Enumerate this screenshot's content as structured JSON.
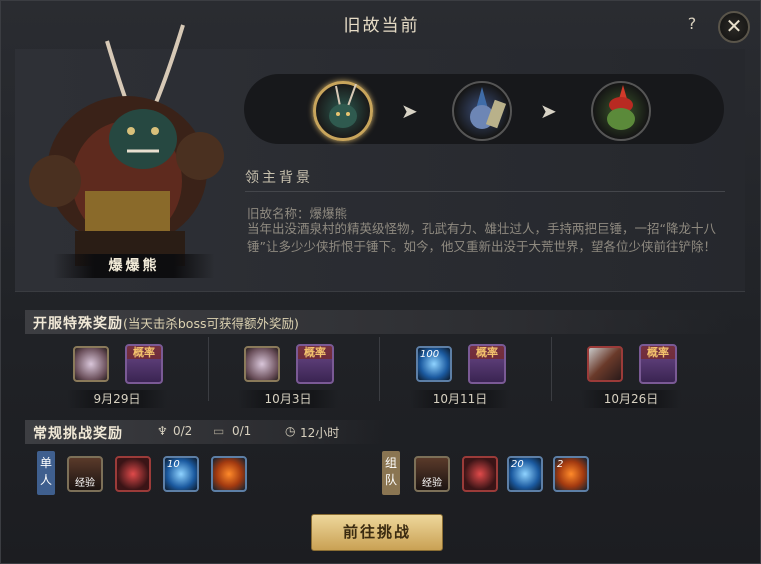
{
  "window": {
    "title": "旧故当前",
    "help": "?",
    "close": "✕"
  },
  "boss": {
    "name": "爆爆熊"
  },
  "progress": {
    "arrow": "➤"
  },
  "background": {
    "section_title": "领主背景",
    "name_line": "旧故名称：爆爆熊",
    "description": "当年出没酒泉村的精英级怪物，孔武有力、雄壮过人，手持两把巨锤，一招“降龙十八锤”让多少少侠折恨于锤下。如今，他又重新出没于大荒世界，望各位少侠前往铲除！"
  },
  "special_rewards": {
    "title": "开服特殊奖励",
    "subtitle": "(当天击杀boss可获得额外奖励)",
    "groups": [
      {
        "date": "9月29日",
        "items": [
          {
            "icon": "mirror-icon",
            "cap": "",
            "num": ""
          },
          {
            "icon": "chance-box-icon",
            "cap": "概率",
            "num": ""
          }
        ]
      },
      {
        "date": "10月3日",
        "items": [
          {
            "icon": "mirror-icon",
            "cap": "",
            "num": ""
          },
          {
            "icon": "chance-box-icon",
            "cap": "概率",
            "num": ""
          }
        ]
      },
      {
        "date": "10月11日",
        "items": [
          {
            "icon": "blue-orb-icon",
            "cap": "",
            "num": "100"
          },
          {
            "icon": "chance-box-icon",
            "cap": "概率",
            "num": ""
          }
        ]
      },
      {
        "date": "10月26日",
        "items": [
          {
            "icon": "scroll-bundle-icon",
            "cap": "",
            "num": ""
          },
          {
            "icon": "chance-box-icon",
            "cap": "概率",
            "num": ""
          }
        ]
      }
    ]
  },
  "regular_rewards": {
    "title": "常规挑战奖励",
    "stat1": "0/2",
    "stat2": "0/1",
    "stat3": "12小时",
    "solo_label": "单人",
    "team_label": "组队",
    "solo_items": [
      {
        "icon": "exp-portrait-icon",
        "sub": "经验",
        "num": ""
      },
      {
        "icon": "red-slash-icon",
        "sub": "",
        "num": ""
      },
      {
        "icon": "blue-orb-icon",
        "sub": "",
        "num": "10"
      },
      {
        "icon": "orange-orb-icon",
        "sub": "",
        "num": ""
      }
    ],
    "team_items": [
      {
        "icon": "exp-portrait-icon",
        "sub": "经验",
        "num": ""
      },
      {
        "icon": "red-slash-icon",
        "sub": "",
        "num": ""
      },
      {
        "icon": "blue-orb-icon",
        "sub": "",
        "num": "20"
      },
      {
        "icon": "orange-orb-icon",
        "sub": "",
        "num": "2"
      }
    ]
  },
  "action": {
    "go_label": "前往挑战"
  }
}
